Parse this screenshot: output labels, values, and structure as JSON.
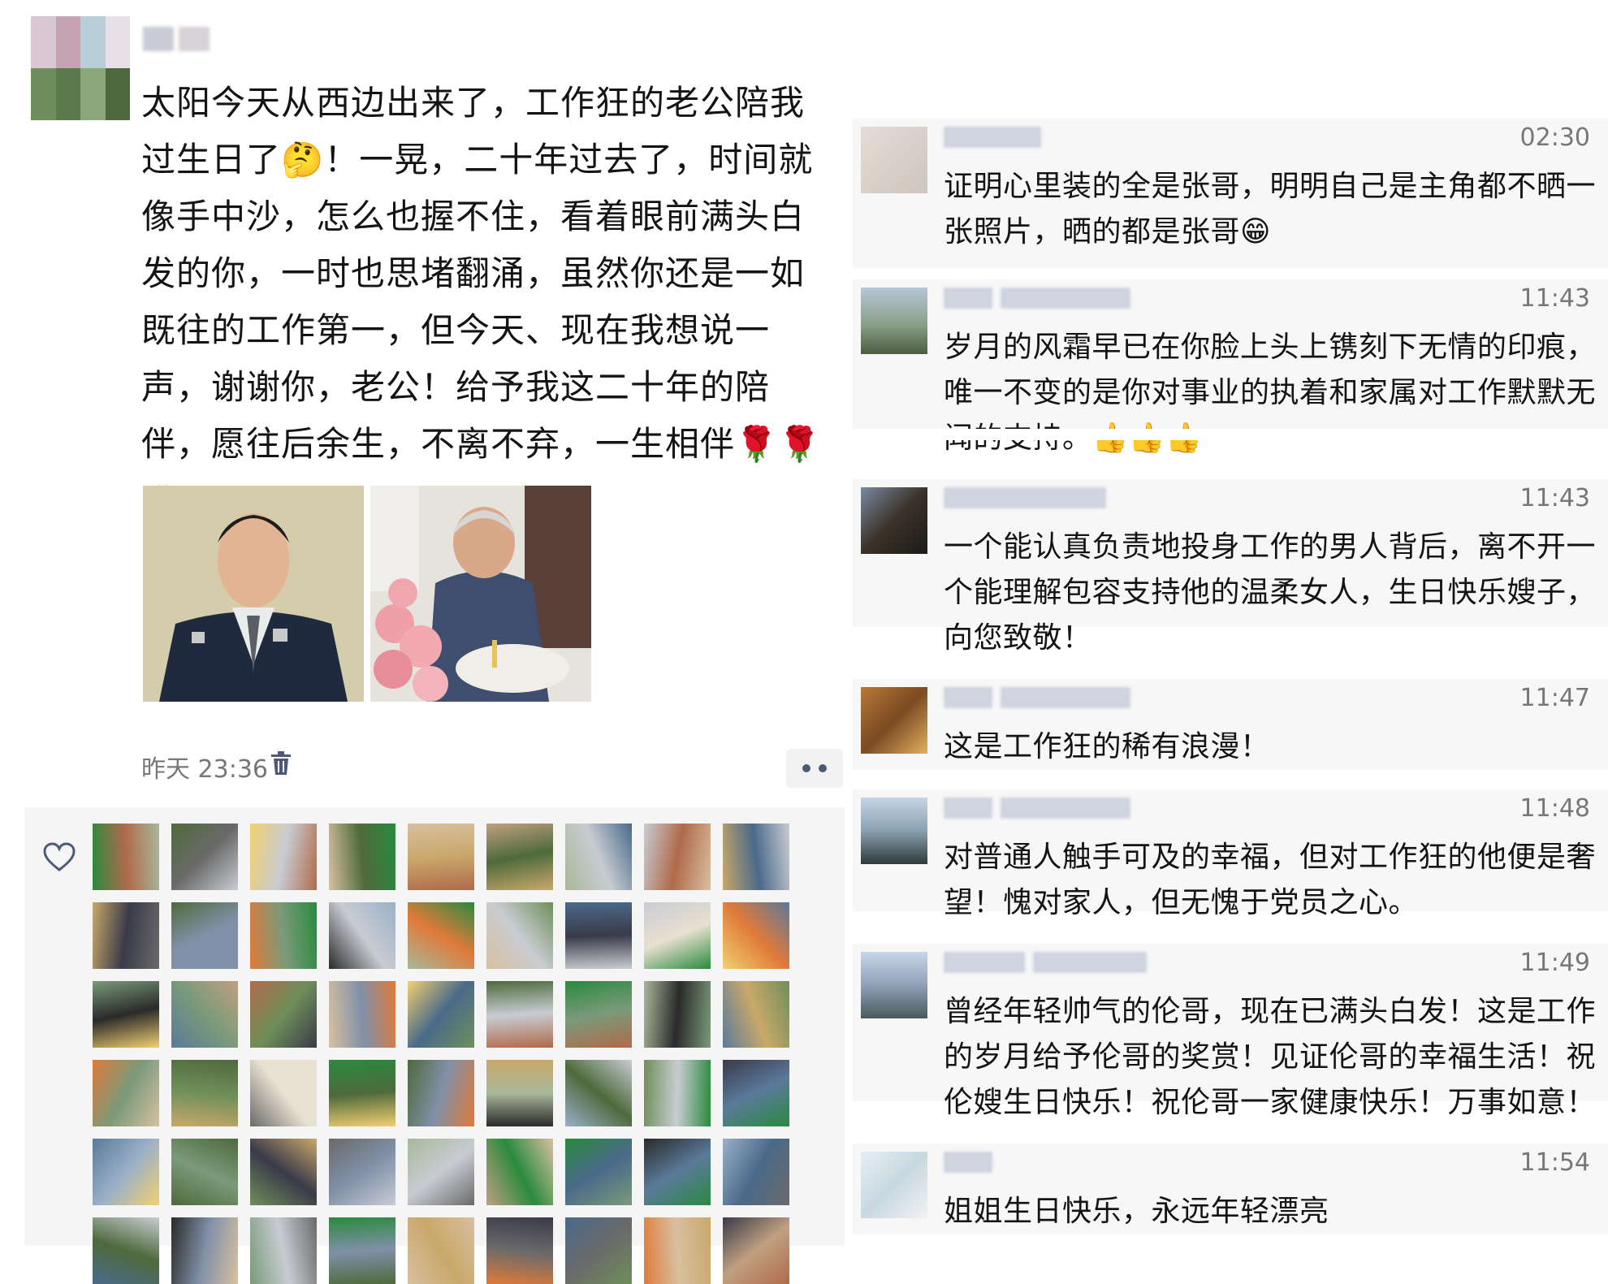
{
  "post": {
    "text": "太阳今天从西边出来了，工作狂的老公陪我过生日了🤔！一晃，二十年过去了，时间就像手中沙，怎么也握不住，看着眼前满头白发的你，一时也思堵翻涌，虽然你还是一如既往的工作第一，但今天、现在我想说一声，谢谢你，老公！给予我这二十年的陪伴，愿往后余生，不离不弃，一生相伴🌹🌹🎂",
    "time": "昨天 23:36"
  },
  "colors": {
    "accent_blue": "#4c5a78",
    "panel_bg": "#f5f5f5"
  },
  "comments": [
    {
      "time": "02:30",
      "text": "证明心里装的全是张哥，明明自己是主角都不晒一张照片，晒的都是张哥😁"
    },
    {
      "time": "11:43",
      "text": "岁月的风霜早已在你脸上头上镌刻下无情的印痕，唯一不变的是你对事业的执着和家属对工作默默无闻的支持。👍👍👍"
    },
    {
      "time": "11:43",
      "text": "一个能认真负责地投身工作的男人背后，离不开一个能理解包容支持他的温柔女人，生日快乐嫂子，向您致敬！"
    },
    {
      "time": "11:47",
      "text": "这是工作狂的稀有浪漫！"
    },
    {
      "time": "11:48",
      "text": "对普通人触手可及的幸福，但对工作狂的他便是奢望！愧对家人，但无愧于党员之心。"
    },
    {
      "time": "11:49",
      "text": "曾经年轻帅气的伦哥，现在已满头白发！这是工作的岁月给予伦哥的奖赏！见证伦哥的幸福生活！祝伦嫂生日快乐！祝伦哥一家健康快乐！万事如意！"
    },
    {
      "time": "11:54",
      "text": "姐姐生日快乐，永远年轻漂亮"
    }
  ]
}
